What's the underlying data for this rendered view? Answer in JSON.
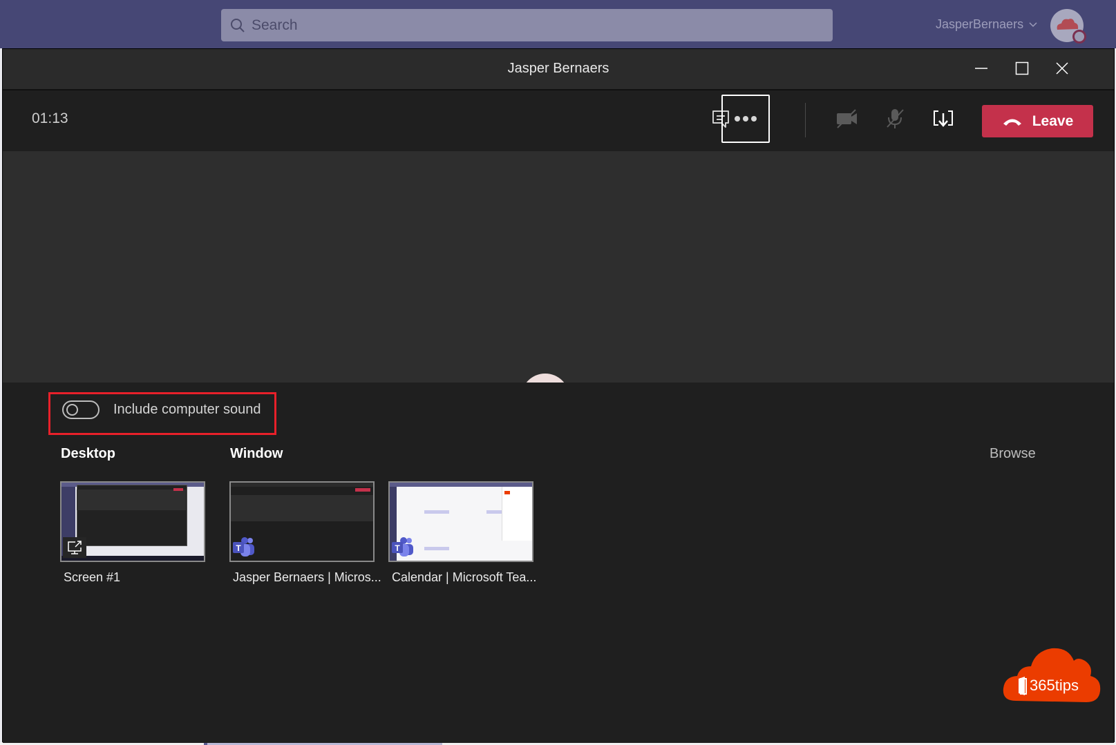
{
  "app": {
    "search_placeholder": "Search",
    "user_name": "JasperBernaers",
    "icons": {
      "search": "search-icon",
      "chevron": "chevron-down-icon",
      "avatar": "avatar"
    }
  },
  "window": {
    "title": "Jasper Bernaers",
    "controls": {
      "minimize": "minimize-icon",
      "maximize": "maximize-icon",
      "close": "close-icon"
    }
  },
  "call_toolbar": {
    "timer": "01:13",
    "buttons": [
      {
        "name": "chat",
        "icon": "chat-icon",
        "state": "enabled"
      },
      {
        "name": "more-actions",
        "icon": "ellipsis-icon",
        "state": "focused"
      },
      {
        "name": "camera",
        "icon": "camera-off-icon",
        "state": "off"
      },
      {
        "name": "microphone",
        "icon": "mic-off-icon",
        "state": "off"
      },
      {
        "name": "share-tray",
        "icon": "share-tray-icon",
        "state": "active"
      }
    ],
    "leave_label": "Leave",
    "leave_color": "#c4314b"
  },
  "share_tray": {
    "include_sound_label": "Include computer sound",
    "include_sound_on": false,
    "desktop_heading": "Desktop",
    "window_heading": "Window",
    "browse_label": "Browse",
    "highlight_color": "#e8202a",
    "sources": [
      {
        "type": "desktop",
        "label": "Screen #1"
      },
      {
        "type": "window",
        "label": "Jasper Bernaers | Micros..."
      },
      {
        "type": "window",
        "label": "Calendar | Microsoft Tea..."
      }
    ]
  },
  "watermark": {
    "text": "365tips",
    "color": "#eb3c00"
  }
}
